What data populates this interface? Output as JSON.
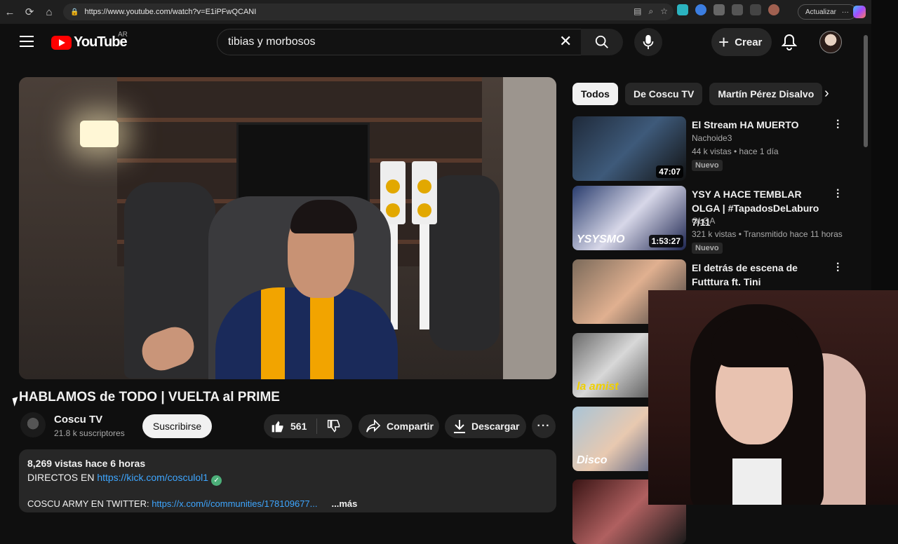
{
  "browser": {
    "url": "https://www.youtube.com/watch?v=E1iPFwQCANI",
    "update_label": "Actualizar"
  },
  "header": {
    "logo_text": "YouTube",
    "region": "AR",
    "search_value": "tibias y morbosos",
    "create_label": "Crear"
  },
  "video": {
    "title": "HABLAMOS de TODO | VUELTA al PRIME",
    "channel": "Coscu TV",
    "subscribers": "21.8 k suscriptores",
    "subscribe_label": "Suscribirse",
    "likes": "561",
    "share_label": "Compartir",
    "download_label": "Descargar"
  },
  "description": {
    "meta": "8,269 vistas  hace 6 horas",
    "line2_text": "DIRECTOS EN ",
    "line2_link": "https://kick.com/cosculol1",
    "line3_text": "COSCU ARMY EN TWITTER: ",
    "line3_link": "https://x.com/i/communities/178109677...",
    "more_label": "...más"
  },
  "chips": [
    "Todos",
    "De Coscu TV",
    "Martín Pérez Disalvo"
  ],
  "recommendations": [
    {
      "title": "El Stream HA MUERTO",
      "channel": "Nachoide3",
      "stats": "44 k vistas • hace 1 día",
      "badge": "Nuevo",
      "duration": "47:07"
    },
    {
      "title": "YSY A HACE TEMBLAR OLGA | #TapadosDeLaburo 7/11",
      "channel": "OLGA",
      "stats": "321 k vistas • Transmitido hace 11 horas",
      "badge": "Nuevo",
      "duration": "1:53:27",
      "thumb_text": "YSYSMO"
    },
    {
      "title": "El detrás de escena de Futttura ft. Tini",
      "channel": "",
      "stats": "",
      "badge": "",
      "duration": ""
    },
    {
      "title": "",
      "channel": "",
      "stats": "",
      "badge": "",
      "duration": "",
      "thumb_text": "la amist"
    },
    {
      "title": "",
      "channel": "",
      "stats": "",
      "badge": "",
      "duration": "",
      "thumb_text": "Disco"
    },
    {
      "title": "",
      "channel": "",
      "stats": "",
      "badge": "",
      "duration": ""
    }
  ],
  "colors": {
    "brand_red": "#ff0000",
    "link": "#3ea6ff",
    "background": "#0f0f0f"
  }
}
